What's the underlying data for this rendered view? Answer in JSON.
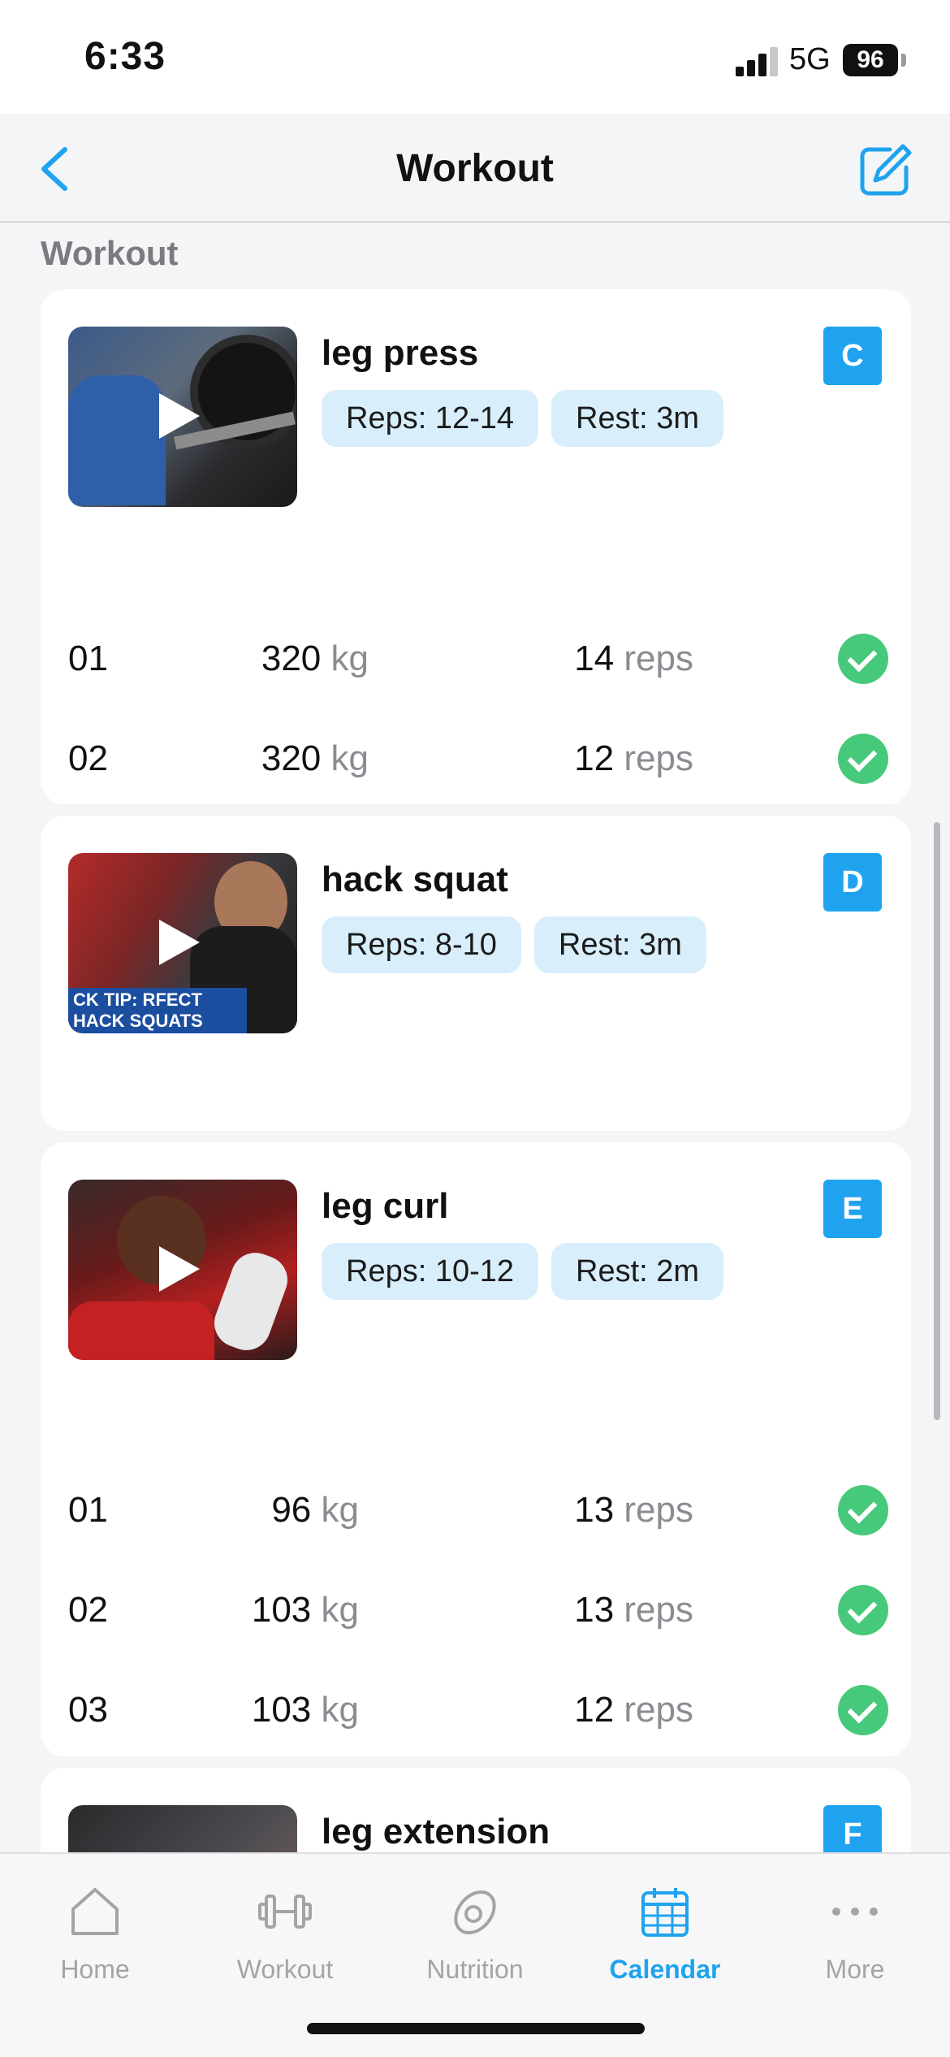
{
  "status": {
    "time": "6:33",
    "network": "5G",
    "battery": "96"
  },
  "header": {
    "title": "Workout"
  },
  "section_label": "Workout",
  "exercises": [
    {
      "name": "leg press",
      "reps": "Reps: 12-14",
      "rest": "Rest: 3m",
      "badge": "C",
      "sets": [
        {
          "num": "01",
          "weight": "320",
          "wunit": "kg",
          "reps": "14",
          "runit": "reps"
        },
        {
          "num": "02",
          "weight": "320",
          "wunit": "kg",
          "reps": "12",
          "runit": "reps"
        }
      ]
    },
    {
      "name": "hack squat",
      "reps": "Reps: 8-10",
      "rest": "Rest: 3m",
      "badge": "D",
      "thumb_text": "CK TIP: RFECT HACK SQUATS",
      "sets": []
    },
    {
      "name": "leg curl",
      "reps": "Reps: 10-12",
      "rest": "Rest: 2m",
      "badge": "E",
      "sets": [
        {
          "num": "01",
          "weight": "96",
          "wunit": "kg",
          "reps": "13",
          "runit": "reps"
        },
        {
          "num": "02",
          "weight": "103",
          "wunit": "kg",
          "reps": "13",
          "runit": "reps"
        },
        {
          "num": "03",
          "weight": "103",
          "wunit": "kg",
          "reps": "12",
          "runit": "reps"
        }
      ]
    },
    {
      "name": "leg extension",
      "badge": "F"
    }
  ],
  "tabs": [
    {
      "label": "Home",
      "icon": "home-icon"
    },
    {
      "label": "Workout",
      "icon": "dumbbell-icon"
    },
    {
      "label": "Nutrition",
      "icon": "avocado-icon"
    },
    {
      "label": "Calendar",
      "icon": "calendar-icon",
      "active": true
    },
    {
      "label": "More",
      "icon": "more-dots-icon"
    }
  ],
  "colors": {
    "accent": "#1fa3ef",
    "check": "#47c97b",
    "pill": "#d8eefb"
  }
}
